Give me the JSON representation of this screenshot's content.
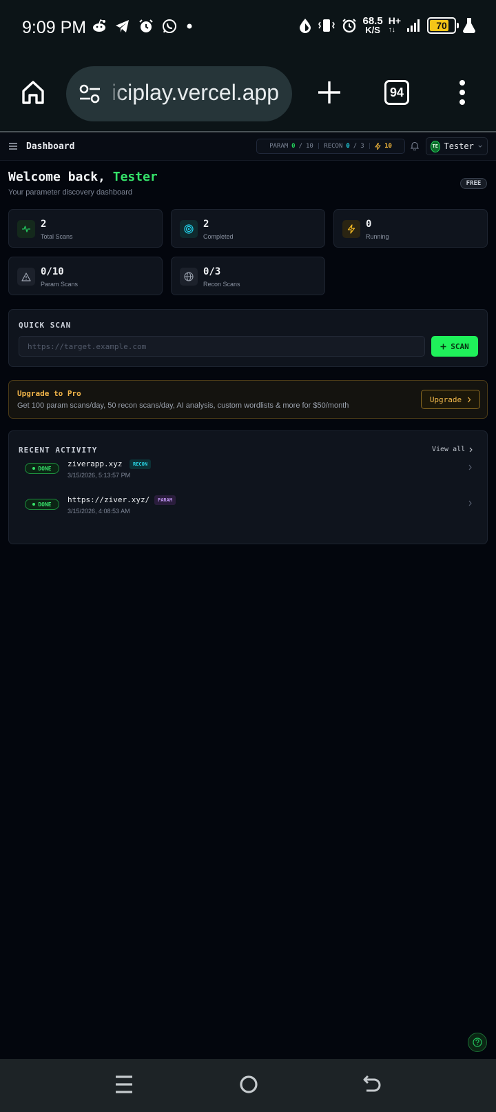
{
  "status_bar": {
    "time": "9:09 PM",
    "net_speed_value": "68.5",
    "net_speed_unit": "K/S",
    "network_type": "H+",
    "battery_level": "70"
  },
  "browser": {
    "url": "iciplay.vercel.app",
    "tab_count": "94"
  },
  "header": {
    "title": "Dashboard",
    "quota": {
      "param_label": "PARAM",
      "param_used": "0",
      "param_limit": "10",
      "recon_label": "RECON",
      "recon_used": "0",
      "recon_limit": "3",
      "credits": "10"
    },
    "user": {
      "initials": "TE",
      "name": "Tester"
    }
  },
  "welcome": {
    "greeting": "Welcome back,",
    "username": "Tester",
    "subtitle": "Your parameter discovery dashboard",
    "plan": "FREE"
  },
  "stats": [
    {
      "value": "2",
      "label": "Total Scans",
      "icon": "activity-icon",
      "color": "#22c55e"
    },
    {
      "value": "2",
      "label": "Completed",
      "icon": "target-icon",
      "color": "#22d3ee"
    },
    {
      "value": "0",
      "label": "Running",
      "icon": "zap-icon",
      "color": "#fbbf24"
    },
    {
      "value": "0/10",
      "label": "Param Scans",
      "icon": "alert-triangle-icon",
      "color": "#9ca3af"
    },
    {
      "value": "0/3",
      "label": "Recon Scans",
      "icon": "globe-icon",
      "color": "#9ca3af"
    }
  ],
  "quick_scan": {
    "title": "QUICK SCAN",
    "placeholder": "https://target.example.com",
    "button_label": "SCAN"
  },
  "upgrade": {
    "title": "Upgrade to Pro",
    "description": "Get 100 param scans/day, 50 recon scans/day, AI analysis, custom wordlists & more for $50/month",
    "button_label": "Upgrade"
  },
  "recent_activity": {
    "title": "RECENT ACTIVITY",
    "view_all_label": "View all",
    "items": [
      {
        "status": "DONE",
        "target": "ziverapp.xyz",
        "type": "RECON",
        "timestamp": "3/15/2026, 5:13:57 PM"
      },
      {
        "status": "DONE",
        "target": "https://ziver.xyz/",
        "type": "PARAM",
        "timestamp": "3/15/2026, 4:08:53 AM"
      }
    ]
  },
  "colors": {
    "accent_green": "#1ff05a",
    "accent_cyan": "#22d3ee",
    "accent_amber": "#f3b64a",
    "background": "#03060d"
  }
}
